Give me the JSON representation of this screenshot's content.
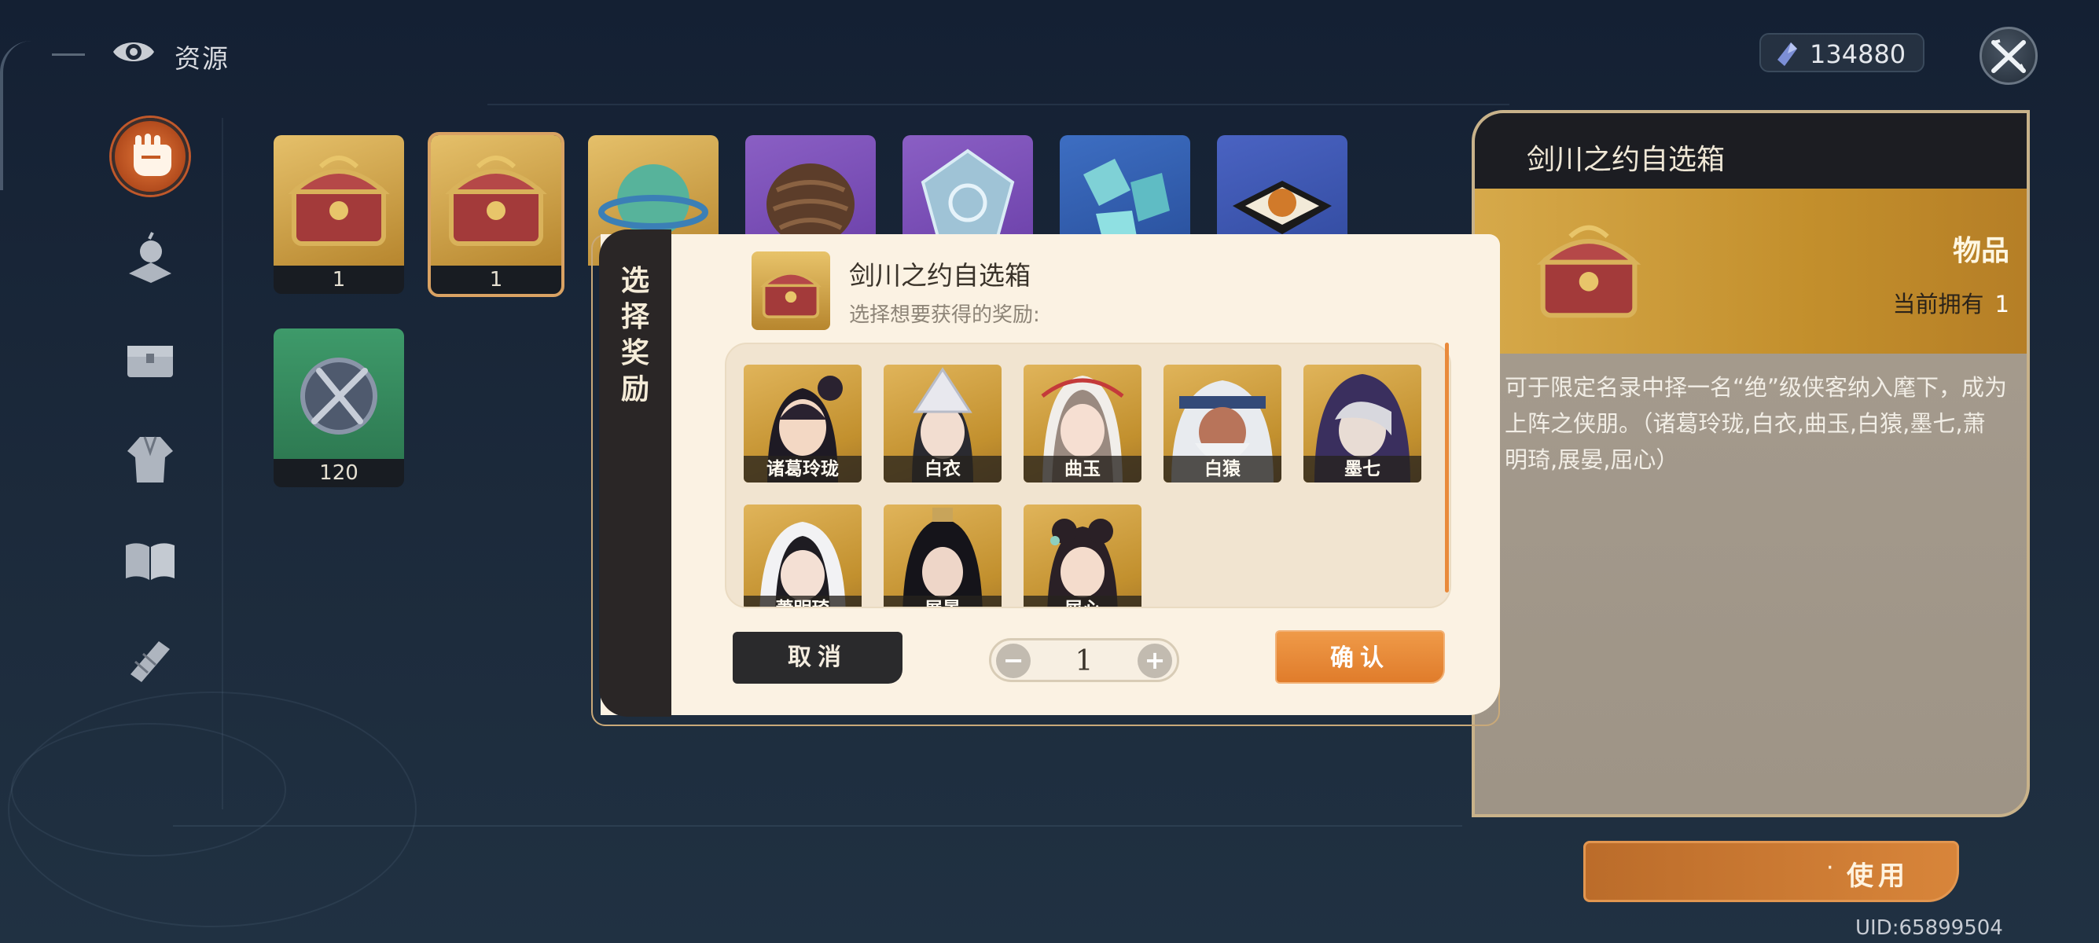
{
  "header": {
    "title": "资源"
  },
  "currency": {
    "value": "134880",
    "icon": "crystal-icon"
  },
  "sidebar": {
    "items": [
      {
        "name": "sidebar-item-resources",
        "icon": "fist-icon",
        "active": true
      },
      {
        "name": "sidebar-item-growth",
        "icon": "potion-icon"
      },
      {
        "name": "sidebar-item-chest",
        "icon": "chest-icon"
      },
      {
        "name": "sidebar-item-outfit",
        "icon": "robe-icon"
      },
      {
        "name": "sidebar-item-book",
        "icon": "book-icon"
      },
      {
        "name": "sidebar-item-fragment",
        "icon": "scroll-icon"
      }
    ]
  },
  "inventory": [
    {
      "count": "1",
      "kind": "chest"
    },
    {
      "count": "1",
      "kind": "chest",
      "selected": true
    },
    {
      "count": "",
      "kind": "orb"
    },
    {
      "count": "",
      "kind": "pinecone"
    },
    {
      "count": "",
      "kind": "gem"
    },
    {
      "count": "",
      "kind": "shards"
    },
    {
      "count": "",
      "kind": "cake"
    },
    {
      "count": "120",
      "kind": "sword-medal"
    }
  ],
  "detail": {
    "title": "剑川之约自选箱",
    "type": "物品",
    "own_label": "当前拥有",
    "own_count": "1",
    "description": "可于限定名录中择一名“绝”级侠客纳入麾下，成为上阵之侠朋。（诸葛玲珑,白衣,曲玉,白猿,墨七,萧明琦,展晏,屈心）"
  },
  "use_button": {
    "label": "使用",
    "prefix": "·"
  },
  "uid": "UID:65899504",
  "modal": {
    "tab_chars": [
      "选",
      "择",
      "奖",
      "励"
    ],
    "title": "剑川之约自选箱",
    "subtitle": "选择想要获得的奖励:",
    "heroes": [
      {
        "name": "诸葛玲珑"
      },
      {
        "name": "白衣"
      },
      {
        "name": "曲玉"
      },
      {
        "name": "白猿"
      },
      {
        "name": "墨七"
      },
      {
        "name": "萧明琦"
      },
      {
        "name": "展晏"
      },
      {
        "name": "屈心"
      }
    ],
    "cancel": "取消",
    "confirm": "确认",
    "quantity": "1",
    "minus": "−",
    "plus": "+"
  },
  "colors": {
    "accent": "#e07c2b",
    "panel": "#fbf2e3",
    "gold": "#c2902e"
  }
}
